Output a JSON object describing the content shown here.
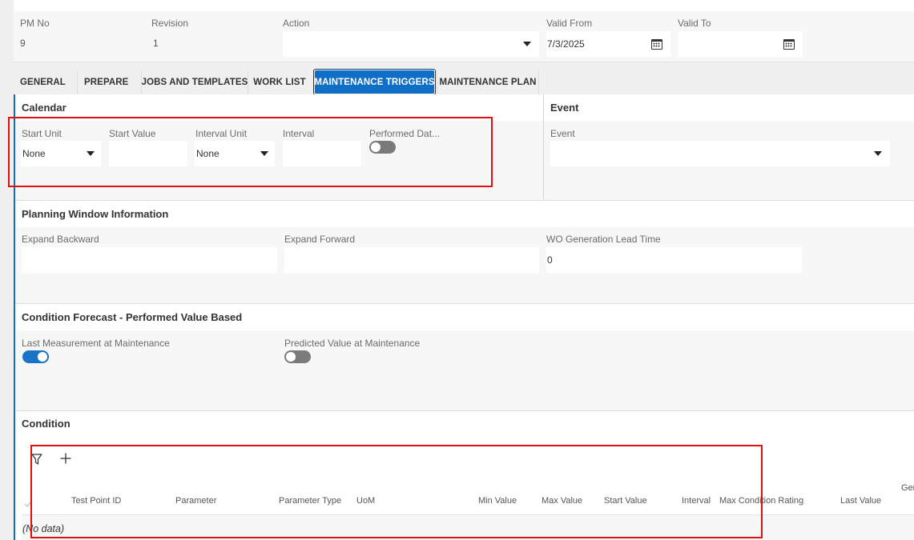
{
  "header": {
    "pm_no": {
      "label": "PM No",
      "value": "9"
    },
    "revision": {
      "label": "Revision",
      "value": "1"
    },
    "action": {
      "label": "Action",
      "value": ""
    },
    "valid_from": {
      "label": "Valid From",
      "value": "7/3/2025"
    },
    "valid_to": {
      "label": "Valid To",
      "value": ""
    }
  },
  "tabs": [
    {
      "label": "GENERAL",
      "active": false
    },
    {
      "label": "PREPARE",
      "active": false
    },
    {
      "label": "JOBS AND TEMPLATES",
      "active": false
    },
    {
      "label": "WORK LIST",
      "active": false
    },
    {
      "label": "MAINTENANCE TRIGGERS",
      "active": true
    },
    {
      "label": "MAINTENANCE PLAN",
      "active": false
    }
  ],
  "calendar": {
    "title": "Calendar",
    "start_unit": {
      "label": "Start Unit",
      "value": "None"
    },
    "start_value": {
      "label": "Start Value",
      "value": ""
    },
    "interval_unit": {
      "label": "Interval Unit",
      "value": "None"
    },
    "interval": {
      "label": "Interval",
      "value": ""
    },
    "performed_date": {
      "label": "Performed Dat...",
      "on": false
    }
  },
  "event": {
    "title": "Event",
    "event_field": {
      "label": "Event",
      "value": ""
    }
  },
  "planning_window": {
    "title": "Planning Window Information",
    "expand_backward": {
      "label": "Expand Backward",
      "value": ""
    },
    "expand_forward": {
      "label": "Expand Forward",
      "value": ""
    },
    "wo_lead_time": {
      "label": "WO Generation Lead Time",
      "value": "0"
    }
  },
  "condition_forecast": {
    "title": "Condition Forecast - Performed Value Based",
    "last_measurement": {
      "label": "Last Measurement at Maintenance",
      "on": true
    },
    "predicted_value": {
      "label": "Predicted Value at Maintenance",
      "on": false
    }
  },
  "condition": {
    "title": "Condition",
    "columns": [
      "Test Point ID",
      "Parameter",
      "Parameter Type",
      "UoM",
      "Min Value",
      "Max Value",
      "Start Value",
      "Interval",
      "Max Condition Rating",
      "Last Value",
      "Gen"
    ],
    "empty_text": "(No data)"
  },
  "colors": {
    "accent": "#0f6fc6",
    "highlight_border": "#e01010",
    "toggle_on": "#1a73c7",
    "toggle_off": "#7a7a7a"
  },
  "icons": [
    "caret-down-icon",
    "calendar-icon",
    "filter-icon",
    "plus-icon",
    "check-icon"
  ]
}
